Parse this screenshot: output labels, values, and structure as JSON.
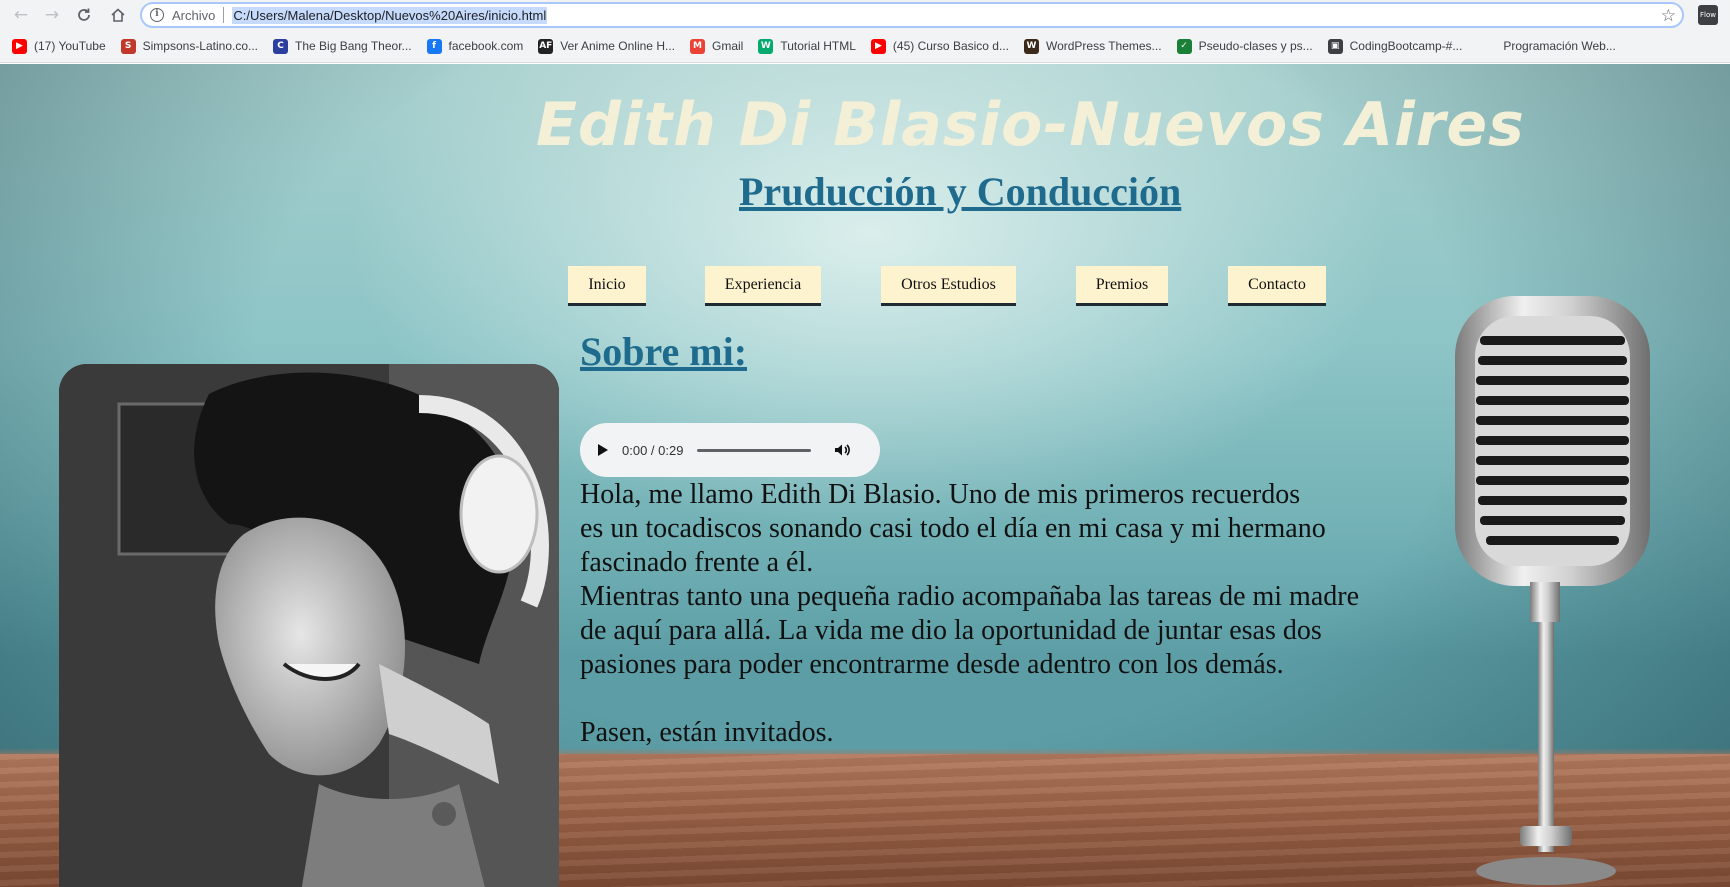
{
  "browser": {
    "scheme_label": "Archivo",
    "url": "C:/Users/Malena/Desktop/Nuevos%20Aires/inicio.html",
    "extension_label": "Flow"
  },
  "bookmarks": [
    {
      "label": "(17) YouTube",
      "icon": "youtube-icon",
      "color": "#ff0000"
    },
    {
      "label": "Simpsons-Latino.co...",
      "icon": "simpsons-icon",
      "color": "#c0392b"
    },
    {
      "label": "The Big Bang Theor...",
      "icon": "bigbang-icon",
      "color": "#2c3e9e"
    },
    {
      "label": "facebook.com",
      "icon": "facebook-icon",
      "color": "#1877f2"
    },
    {
      "label": "Ver Anime Online H...",
      "icon": "anime-icon",
      "color": "#222222"
    },
    {
      "label": "Gmail",
      "icon": "gmail-icon",
      "color": "#ea4335"
    },
    {
      "label": "Tutorial HTML",
      "icon": "w3-icon",
      "color": "#04aa6d"
    },
    {
      "label": "(45) Curso Basico d...",
      "icon": "youtube-icon",
      "color": "#ff0000"
    },
    {
      "label": "WordPress Themes...",
      "icon": "wordpress-icon",
      "color": "#3b2a1a"
    },
    {
      "label": "Pseudo-clases y ps...",
      "icon": "check-icon",
      "color": "#1a7f37"
    },
    {
      "label": "CodingBootcamp-#...",
      "icon": "codingbootcamp-icon",
      "color": "#3c4043"
    },
    {
      "label": "Programación Web...",
      "icon": "none",
      "color": "#f1f3f4"
    }
  ],
  "page": {
    "site_title": "Edith Di Blasio-Nuevos Aires",
    "subtitle": "Pruducción y Conducción",
    "menu": [
      "Inicio",
      "Experiencia",
      "Otros Estudios",
      "Premios",
      "Contacto"
    ],
    "about_heading": "Sobre mi:",
    "audio_time": "0:00 / 0:29",
    "paragraph_lines": [
      "Hola, me llamo Edith Di Blasio. Uno de mis primeros recuerdos",
      "es un tocadiscos sonando casi todo el día en mi casa y mi hermano",
      "fascinado frente a él.",
      "Mientras tanto una pequeña radio acompañaba las tareas de mi madre",
      "de aquí para allá. La vida me dio la oportunidad de juntar esas dos",
      "pasiones para poder encontrarme desde adentro con los demás."
    ],
    "closing_line": "Pasen, están invitados.",
    "colors": {
      "title": "#f4f0d8",
      "link": "#1f6b8e",
      "menu_bg": "#fdf3cf"
    }
  }
}
